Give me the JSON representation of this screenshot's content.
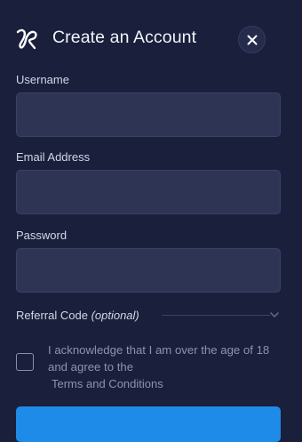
{
  "header": {
    "title": "Create an Account",
    "logo_icon": "brand-logo-icon",
    "close_icon": "close-icon"
  },
  "form": {
    "username": {
      "label": "Username",
      "value": "",
      "placeholder": ""
    },
    "email": {
      "label": "Email Address",
      "value": "",
      "placeholder": ""
    },
    "password": {
      "label": "Password",
      "value": "",
      "placeholder": ""
    },
    "referral": {
      "label": "Referral Code",
      "optional_note": "(optional)",
      "expand_icon": "chevron-down-icon"
    },
    "terms": {
      "checked": false,
      "acknowledge_text": "I acknowledge that I am over the age of 18 and agree to the",
      "link_text": "Terms and Conditions"
    },
    "submit_label": ""
  },
  "colors": {
    "background": "#1a1f3c",
    "input_background": "#2d3454",
    "accent": "#1f8be8",
    "muted_text": "#8d93ad"
  }
}
